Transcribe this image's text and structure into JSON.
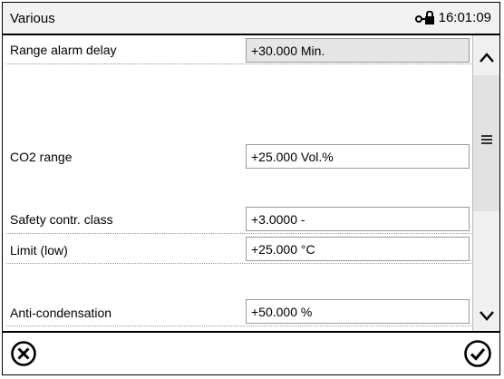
{
  "header": {
    "title": "Various",
    "time": "16:01:09",
    "lock_icon": "key-lock-icon"
  },
  "rows": [
    {
      "label": "Range alarm delay",
      "value": "+30.000 Min.",
      "editable": false
    },
    {
      "label": "CO2 range",
      "value": "+25.000 Vol.%",
      "editable": true
    },
    {
      "label": "Safety contr. class",
      "value": "+3.0000 -",
      "editable": true
    },
    {
      "label": "Limit (low)",
      "value": "+25.000 °C",
      "editable": true
    },
    {
      "label": "Anti-condensation",
      "value": "+50.000 %",
      "editable": true
    }
  ],
  "scrollbar": {
    "up_icon": "chevron-up-icon",
    "grip_icon": "menu-lines-icon",
    "down_icon": "chevron-down-icon"
  },
  "footer": {
    "cancel_icon": "circle-x-icon",
    "confirm_icon": "circle-check-icon"
  },
  "colors": {
    "header_bg": "#f2f2f2",
    "readonly_field_bg": "#e6e6e6",
    "scrollbar_bg": "#f0f0f0"
  }
}
